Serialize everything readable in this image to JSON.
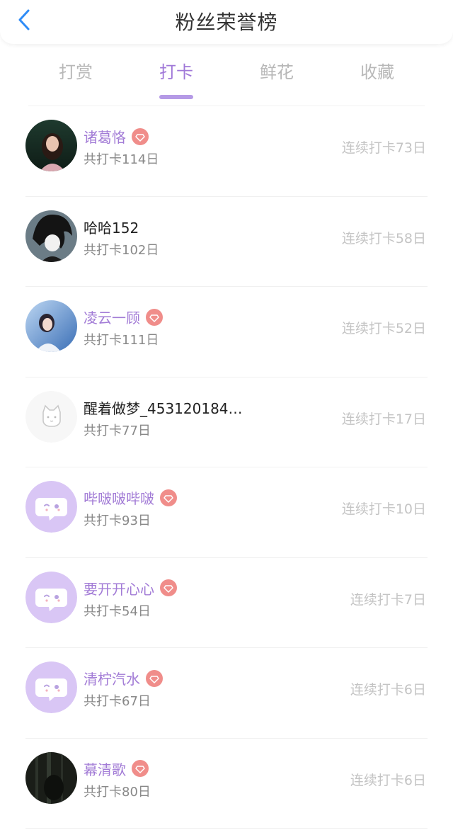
{
  "header": {
    "title": "粉丝荣誉榜",
    "back_icon": "chevron-left-icon"
  },
  "colors": {
    "accent": "#a27bd6",
    "underline": "#b59ae6",
    "badge": "#f08d8a",
    "back": "#2f8cf7"
  },
  "tabs": [
    {
      "label": "打赏",
      "active": false
    },
    {
      "label": "打卡",
      "active": true
    },
    {
      "label": "鲜花",
      "active": false
    },
    {
      "label": "收藏",
      "active": false
    }
  ],
  "fans": [
    {
      "name": "诸葛恪",
      "vip": true,
      "total": "共打卡114日",
      "streak": "连续打卡73日",
      "avatar": "photo-girl"
    },
    {
      "name": "哈哈152",
      "vip": false,
      "total": "共打卡102日",
      "streak": "连续打卡58日",
      "avatar": "photo-dark-hair"
    },
    {
      "name": "凌云一顾",
      "vip": true,
      "total": "共打卡111日",
      "streak": "连续打卡52日",
      "avatar": "photo-blue"
    },
    {
      "name": "醒着做梦_453120184…",
      "vip": false,
      "total": "共打卡77日",
      "streak": "连续打卡17日",
      "avatar": "cat-placeholder"
    },
    {
      "name": "哔啵啵哔啵",
      "vip": true,
      "total": "共打卡93日",
      "streak": "连续打卡10日",
      "avatar": "chat-bubble"
    },
    {
      "name": "要开开心心",
      "vip": true,
      "total": "共打卡54日",
      "streak": "连续打卡7日",
      "avatar": "chat-bubble"
    },
    {
      "name": "清柠汽水",
      "vip": true,
      "total": "共打卡67日",
      "streak": "连续打卡6日",
      "avatar": "chat-bubble"
    },
    {
      "name": "幕清歌",
      "vip": true,
      "total": "共打卡80日",
      "streak": "连续打卡6日",
      "avatar": "photo-dark"
    }
  ]
}
